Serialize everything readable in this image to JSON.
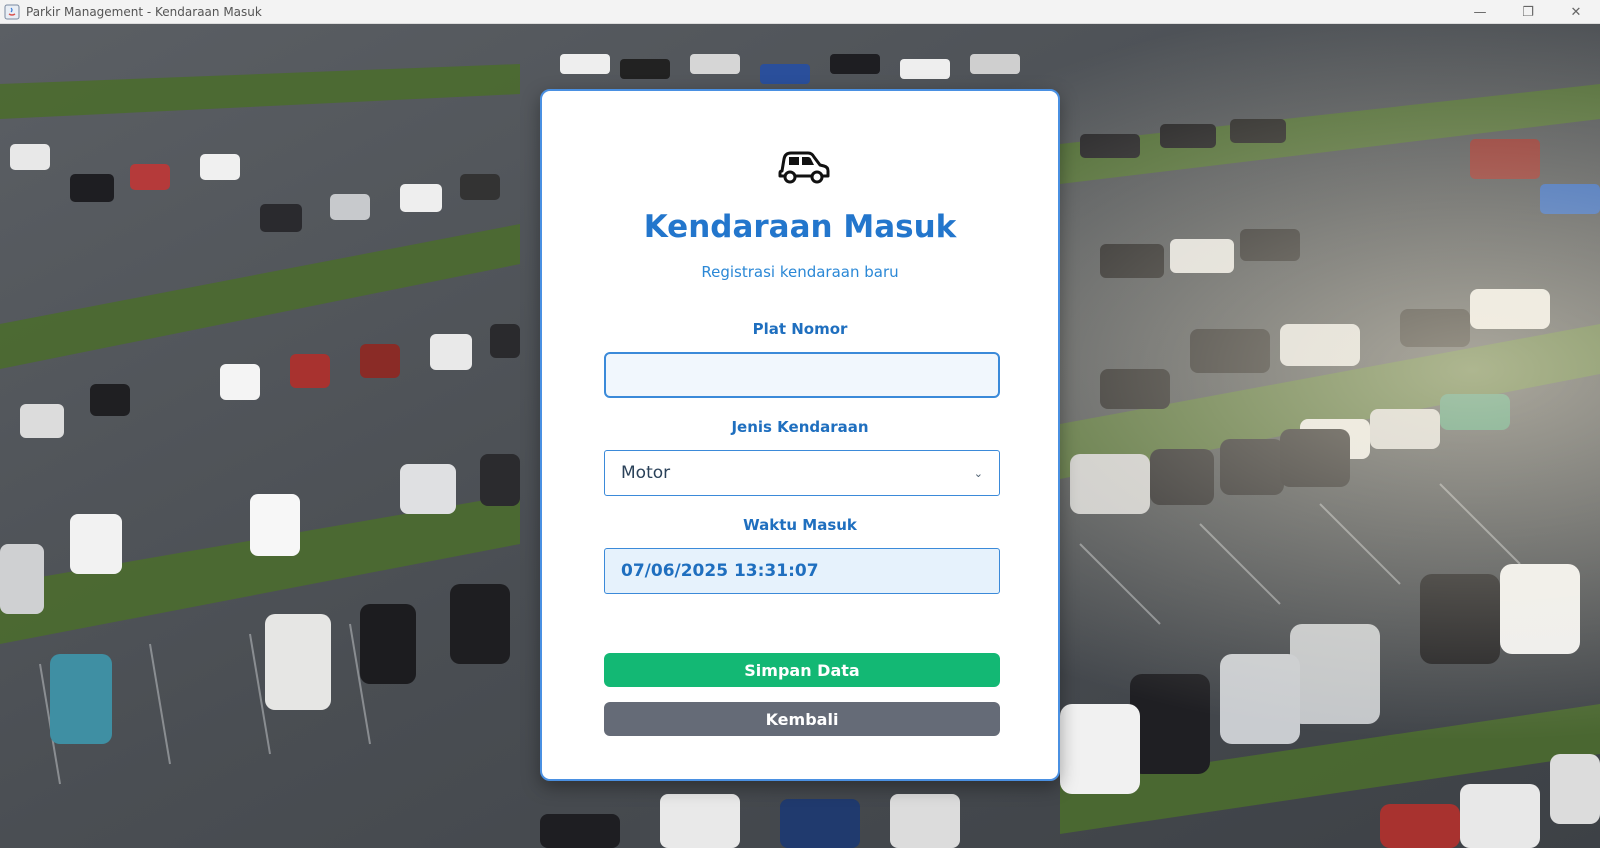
{
  "window": {
    "title": "Parkir Management - Kendaraan Masuk",
    "controls": {
      "minimize": "—",
      "maximize": "❐",
      "close": "✕"
    }
  },
  "card": {
    "icon": "car-icon",
    "title": "Kendaraan Masuk",
    "subtitle": "Registrasi kendaraan baru",
    "fields": {
      "plat": {
        "label": "Plat Nomor",
        "value": "",
        "placeholder": ""
      },
      "jenis": {
        "label": "Jenis Kendaraan",
        "selected": "Motor"
      },
      "waktu": {
        "label": "Waktu Masuk",
        "value": "07/06/2025 13:31:07"
      }
    },
    "buttons": {
      "save": "Simpan Data",
      "back": "Kembali"
    }
  },
  "colors": {
    "accent": "#2376cc",
    "border": "#3b8ad9",
    "save": "#13b874",
    "back": "#656b77"
  }
}
